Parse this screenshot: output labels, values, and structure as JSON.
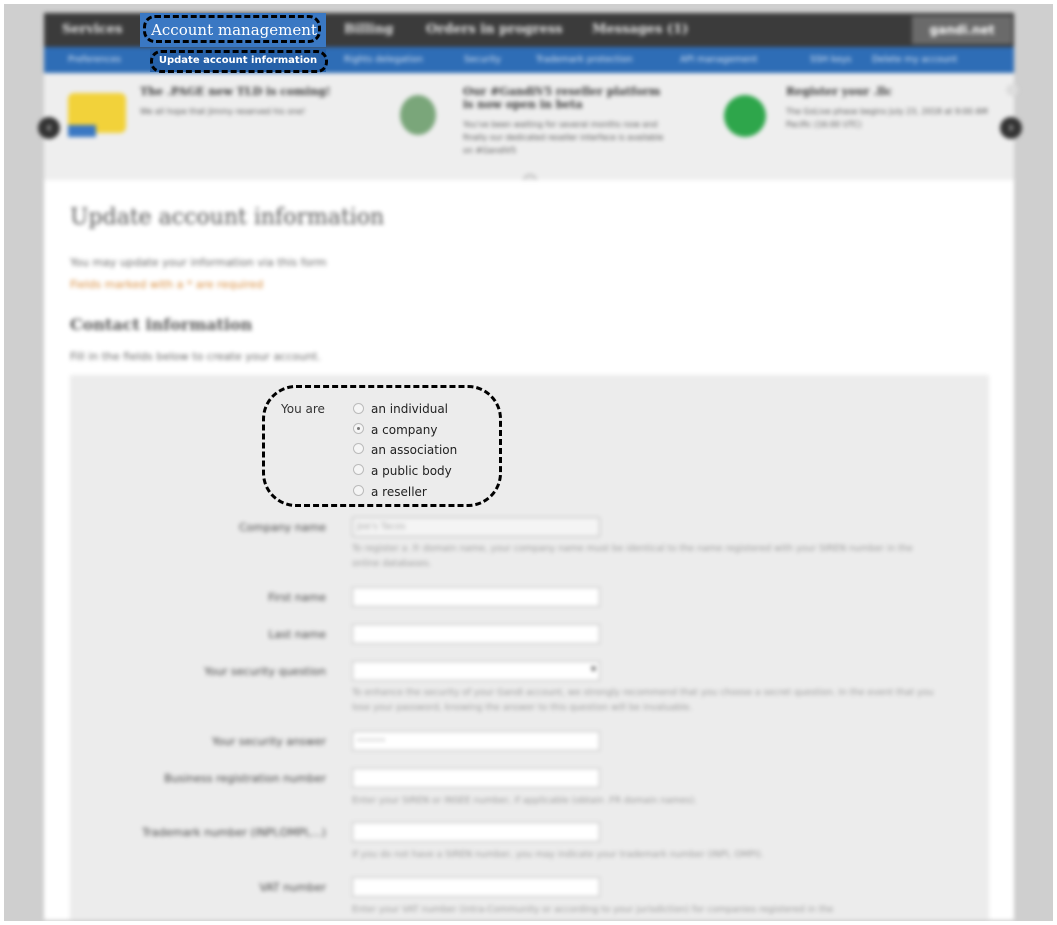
{
  "topnav": {
    "items": [
      "Services",
      "Account management",
      "Billing",
      "Orders in progress",
      "Messages (1)"
    ],
    "domain": "gandi.net"
  },
  "subnav": {
    "items": [
      "Preferences",
      "Update account information",
      "Rights delegation",
      "Security",
      "Trademark protection",
      "API management",
      "SSH keys",
      "Delete my account"
    ]
  },
  "news": [
    {
      "title": "The .PAGE new TLD is coming!",
      "text": "We all hope that Jimmy reserved his one!"
    },
    {
      "title": "Our #GandiV5 reseller platform is now open in beta",
      "text": "You've been waiting for several months now and finally our dedicated reseller interface is available on #GandiV5"
    },
    {
      "title": "Register your .llc",
      "text": "The GoLive phase begins July 23, 2018 at 9:00 AM Pacific (16:00 UTC)"
    }
  ],
  "page": {
    "title": "Update account information",
    "intro": "You may update your information via this form",
    "required_note": "Fields marked with a * are required",
    "section_title": "Contact information",
    "section_intro": "Fill in the fields below to create your account."
  },
  "form": {
    "you_are_label": "You are",
    "options": [
      "an individual",
      "a company",
      "an association",
      "a public body",
      "a reseller"
    ],
    "selected_option": "a company",
    "company_name_label": "Company name",
    "company_name_value": "Joe's Tacos",
    "company_help": "To register a .fr domain name, your company name must be identical to the name registered with your SIREN number in the online databases.",
    "first_name_label": "First name",
    "last_name_label": "Last name",
    "security_question_label": "Your security question",
    "security_help": "To enhance the security of your Gandi account, we strongly recommend that you choose a secret question. In the event that you lose your password, knowing the answer to this question will be invaluable.",
    "security_answer_label": "Your security answer",
    "security_answer_value": "••••••",
    "brn_label": "Business registration number",
    "brn_help": "Enter your SIREN or INSEE number, if applicable (obtain .FR domain names).",
    "trademark_label": "Trademark number (INPI,OMPI,...)",
    "trademark_help": "If you do not have a SIREN number, you may indicate your trademark number (INPI, OMPI).",
    "vat_label": "VAT number",
    "vat_help": "Enter your VAT number (intra-Community or according to your jurisdiction) for companies registered in the"
  }
}
